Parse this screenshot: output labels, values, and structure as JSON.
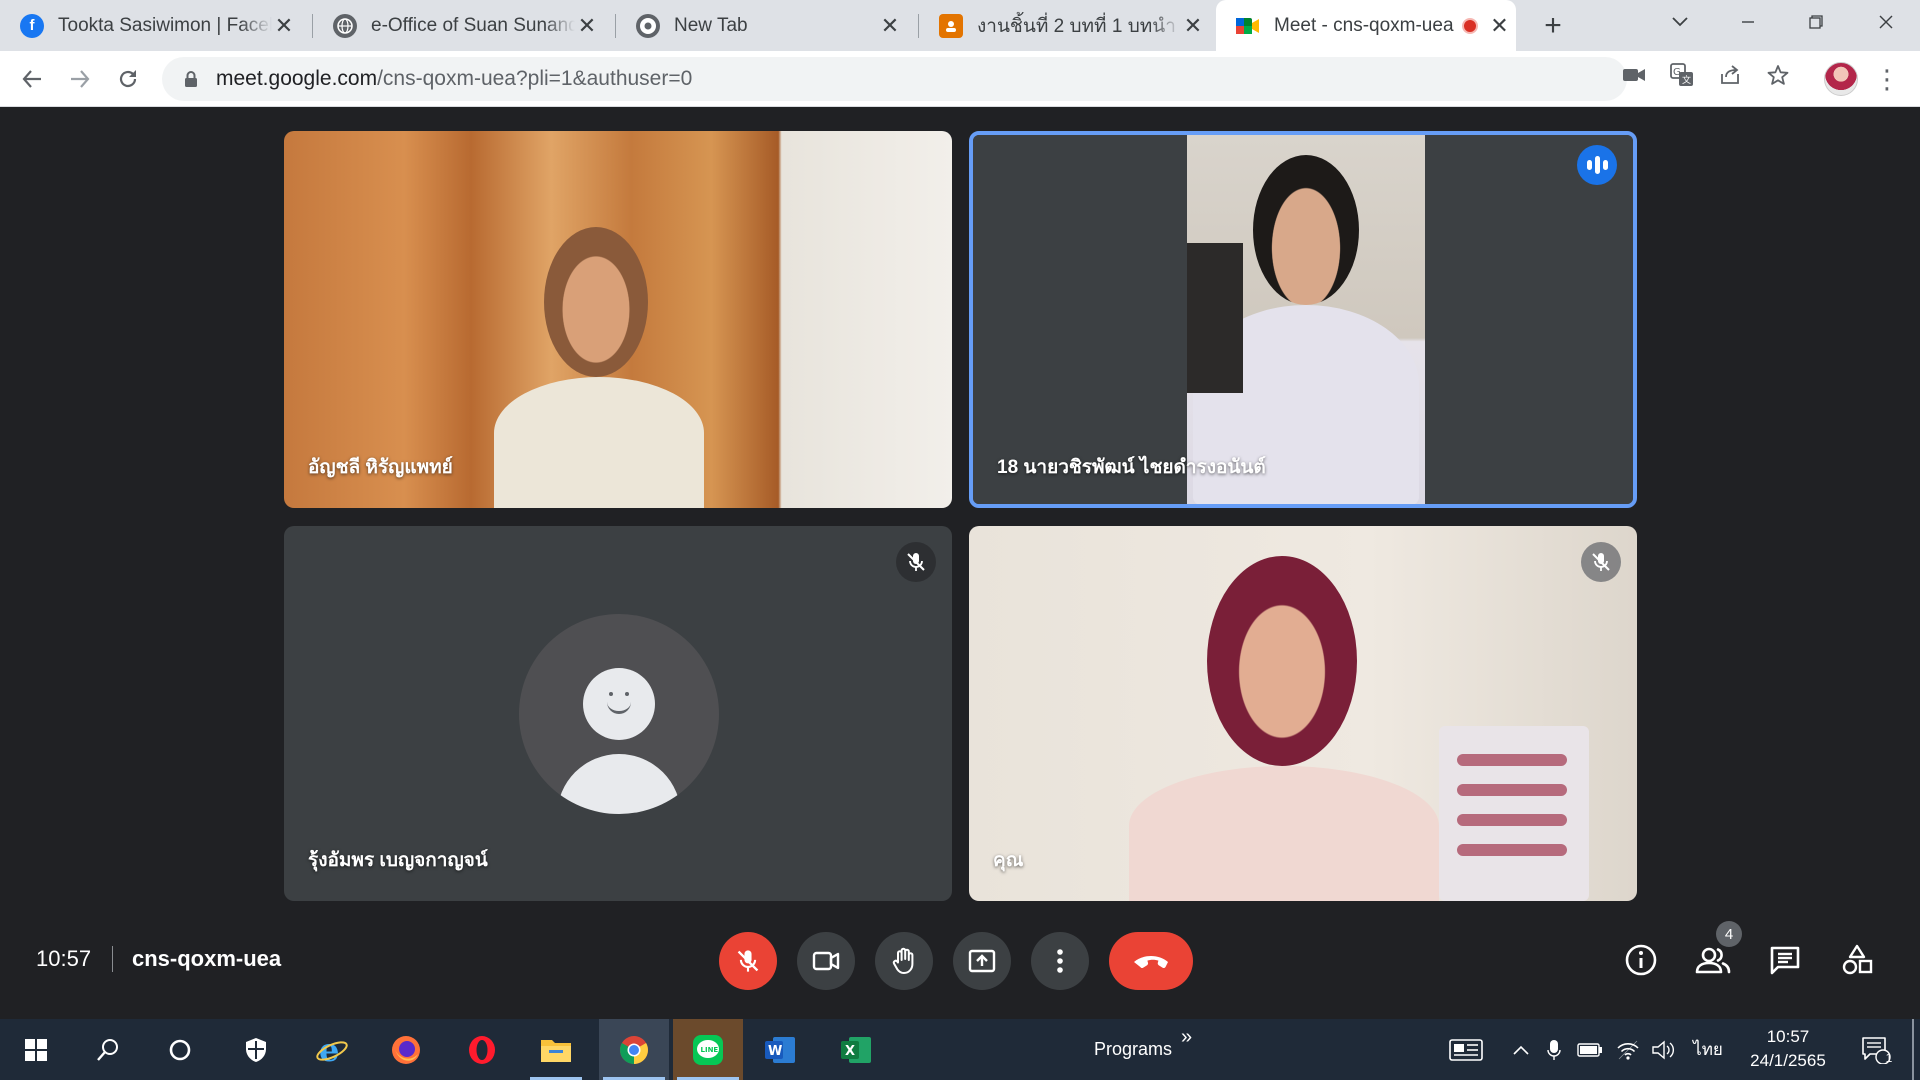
{
  "browser": {
    "tabs": [
      {
        "title": "Tookta Sasiwimon | Faceb",
        "favicon": "facebook-icon",
        "color": "#1877f2"
      },
      {
        "title": "e-Office of Suan Sunandh",
        "favicon": "globe-icon",
        "color": "#5f6368"
      },
      {
        "title": "New Tab",
        "favicon": "chrome-icon",
        "color": "#5f6368"
      },
      {
        "title": "งานชิ้นที่ 2 บทที่ 1 บทนำ",
        "favicon": "classroom-icon",
        "color": "#e37400"
      },
      {
        "title": "Meet - cns-qoxm-uea",
        "favicon": "meet-icon",
        "color": "#00832d",
        "active": true
      }
    ],
    "url_host": "meet.google.com",
    "url_path": "/cns-qoxm-uea?pli=1&authuser=0"
  },
  "meet": {
    "participants": [
      {
        "name": "อัญชลี หิรัญแพทย์"
      },
      {
        "name": "18 นายวชิรพัฒน์ ไชยดำรงอนันต์",
        "speaking": true
      },
      {
        "name": "รุ้งอัมพร เบญจกาญจน์",
        "muted": true
      },
      {
        "name": "คุณ",
        "muted": true
      }
    ],
    "clock": "10:57",
    "meeting_code": "cns-qoxm-uea",
    "people_count": "4",
    "accent": "#ea4335"
  },
  "taskbar": {
    "programs_label": "Programs",
    "chevron": "»",
    "language": "ไทย",
    "time": "10:57",
    "date": "24/1/2565",
    "notifications": "1"
  }
}
